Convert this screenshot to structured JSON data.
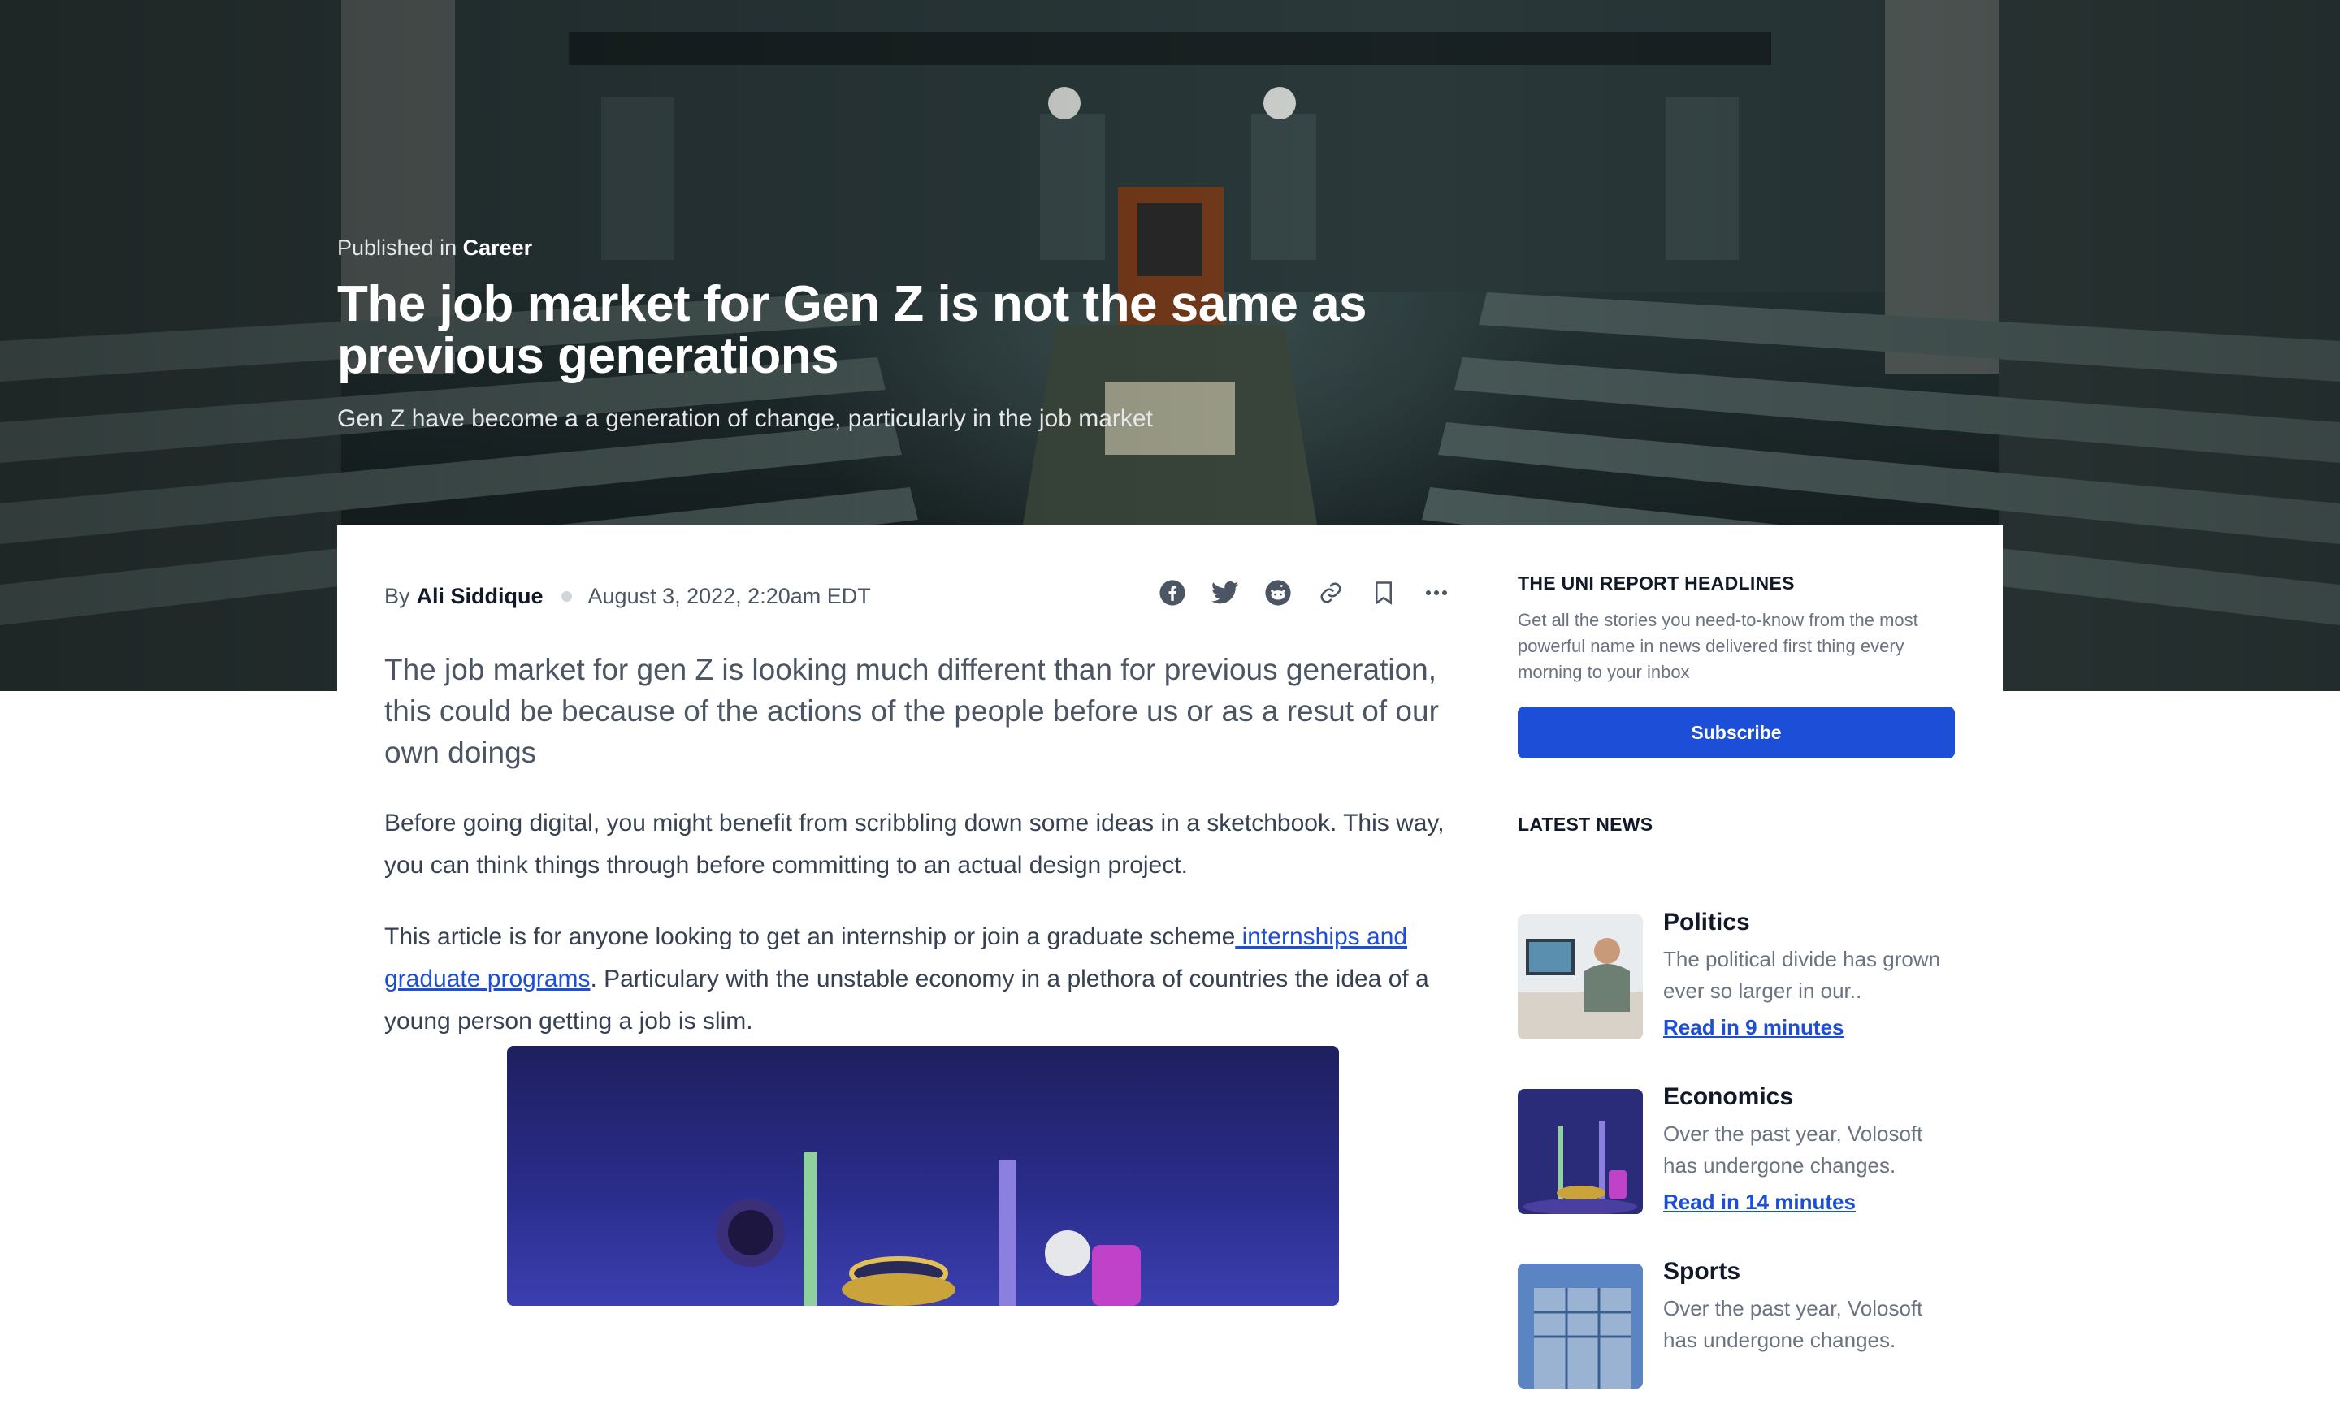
{
  "hero": {
    "published_prefix": "Published in",
    "category": "Career",
    "title": "The job market for Gen Z is not the same as previous generations",
    "subtitle": "Gen Z have become a a generation of change, particularly in the job market"
  },
  "meta": {
    "by": "By",
    "author": "Ali Siddique",
    "date": "August 3, 2022, 2:20am EDT"
  },
  "share_icons": [
    "facebook-icon",
    "twitter-icon",
    "reddit-icon",
    "link-icon",
    "bookmark-icon",
    "more-icon"
  ],
  "article": {
    "lead": "The job market for gen Z is looking much different than for previous generation, this could be because of the actions of the people before us or as a resut of our own doings",
    "para1": "Before going digital, you might benefit from scribbling down some ideas in a sketchbook. This way, you can think things through before committing to an actual design project.",
    "para2_before": "This article is for anyone looking to get an internship or join a graduate scheme",
    "para2_link": " internships and graduate programs",
    "para2_after": ". Particulary with the unstable economy in a plethora of countries the idea of a young person getting a job is slim."
  },
  "sidebar": {
    "headlines_title": "THE UNI REPORT HEADLINES",
    "headlines_desc": "Get all the stories you need-to-know from the most powerful name in news delivered first thing every morning to your inbox",
    "subscribe_label": "Subscribe",
    "latest_title": "LATEST NEWS",
    "news": [
      {
        "category": "Politics",
        "summary": "The political divide has grown ever so larger in our..",
        "read": "Read in 9 minutes"
      },
      {
        "category": "Economics",
        "summary": "Over the past year, Volosoft has undergone changes.",
        "read": "Read in 14 minutes"
      },
      {
        "category": "Sports",
        "summary": "Over the past year, Volosoft has undergone changes.",
        "read": ""
      }
    ]
  },
  "colors": {
    "accent": "#1d4ed8",
    "card_bg": "#ffffff",
    "hero_dark": "#1d2a2b"
  }
}
